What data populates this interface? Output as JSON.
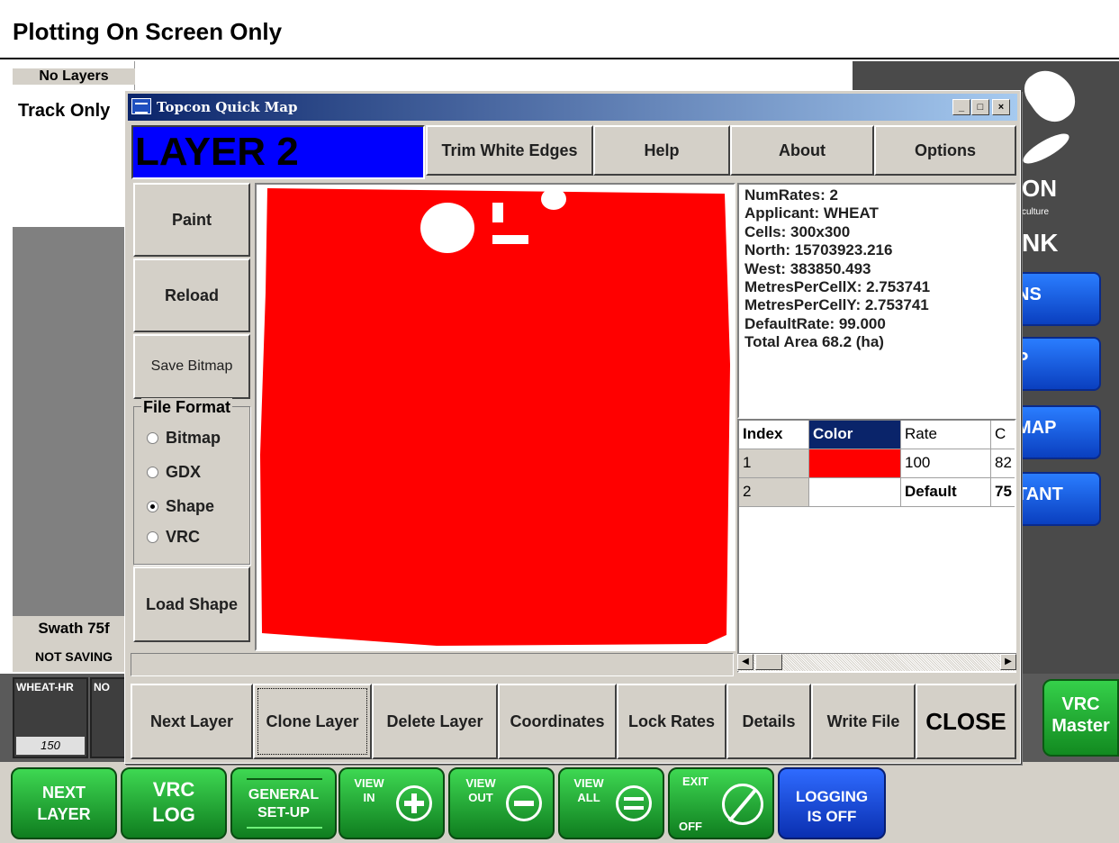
{
  "app": {
    "title": "Plotting On Screen Only",
    "layers_header": "No Layers",
    "track_only": "Track Only",
    "swath": "Swath 75f",
    "saving_status": "NOT SAVING"
  },
  "brand": {
    "logo_text": "ON",
    "logo_sub": "culture",
    "link_text": "NK",
    "side_buttons": [
      "NS",
      "P",
      "MAP",
      "TANT"
    ]
  },
  "layer_tiles": [
    {
      "name": "WHEAT-HR",
      "value": "150"
    },
    {
      "name": "NO",
      "value": ""
    }
  ],
  "vrc_master": {
    "line1": "VRC",
    "line2": "Master"
  },
  "bottom_toolbar": {
    "next_layer": [
      "NEXT",
      "LAYER"
    ],
    "vrc_log": [
      "VRC",
      "LOG"
    ],
    "general_setup": [
      "GENERAL",
      "SET-UP"
    ],
    "view_in": "VIEW IN",
    "view_out": "VIEW OUT",
    "view_all": "VIEW ALL",
    "exit_off": {
      "top": "EXIT",
      "bottom": "OFF"
    },
    "logging": [
      "LOGGING",
      "IS OFF"
    ]
  },
  "dialog": {
    "title": "Topcon Quick Map",
    "layer_name": "LAYER 2",
    "top_buttons": {
      "trim": "Trim White Edges",
      "help": "Help",
      "about": "About",
      "options": "Options"
    },
    "left_buttons": {
      "paint": "Paint",
      "reload": "Reload",
      "save_bitmap": "Save Bitmap",
      "load_shape": "Load Shape"
    },
    "file_format": {
      "legend": "File Format",
      "options": [
        "Bitmap",
        "GDX",
        "Shape",
        "VRC"
      ],
      "selected": "Shape"
    },
    "info_lines": [
      "NumRates: 2",
      "Applicant: WHEAT",
      "Cells: 300x300",
      "North: 15703923.216",
      "West: 383850.493",
      "MetresPerCellX: 2.753741",
      "MetresPerCellY: 2.753741",
      "DefaultRate: 99.000",
      "Total Area 68.2 (ha)"
    ],
    "rates_table": {
      "headers": [
        "Index",
        "Color",
        "Rate",
        "C"
      ],
      "rows": [
        {
          "index": "1",
          "color": "#ff0000",
          "rate": "100",
          "c": "82"
        },
        {
          "index": "2",
          "color": "#ffffff",
          "rate": "Default",
          "c": "75"
        }
      ]
    },
    "bottom_buttons": {
      "next_layer": "Next Layer",
      "clone_layer": "Clone Layer",
      "delete_layer": "Delete Layer",
      "coordinates": "Coordinates",
      "lock_rates": "Lock Rates",
      "details": "Details",
      "write_file": "Write File",
      "close": "CLOSE"
    },
    "map_fill_color": "#ff0000",
    "layer_label_color": "#0000ff"
  }
}
